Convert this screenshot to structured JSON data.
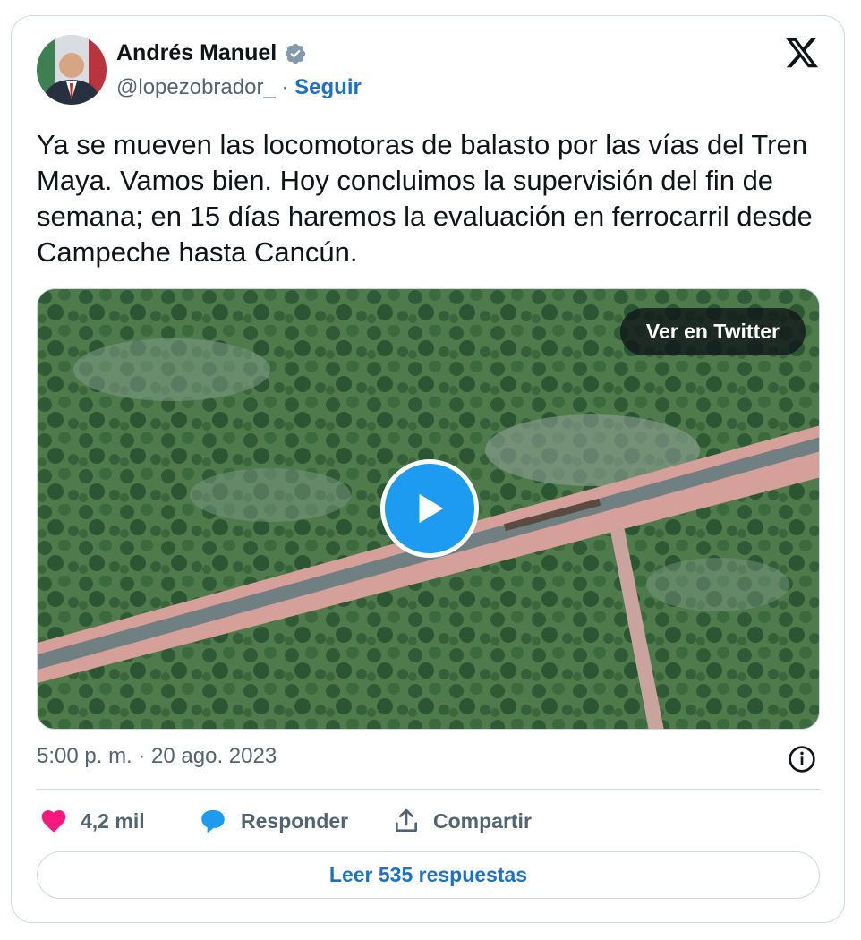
{
  "author": {
    "name": "Andrés Manuel",
    "handle": "@lopezobrador_",
    "separator": "·",
    "follow_label": "Seguir",
    "verified_icon": "verified-badge-icon"
  },
  "tweet": {
    "text": "Ya se mueven las locomotoras de balasto por las vías del Tren Maya. Vamos bien. Hoy concluimos la supervisión del fin de semana; en 15 días haremos la evaluación en ferrocarril desde Campeche hasta Cancún.",
    "timestamp": "5:00 p. m. · 20 ago. 2023"
  },
  "media": {
    "type": "video",
    "view_on_twitter_label": "Ver en Twitter",
    "play_icon": "play-icon"
  },
  "actions": {
    "likes_count": "4,2 mil",
    "reply_label": "Responder",
    "share_label": "Compartir"
  },
  "read_replies_label": "Leer 535 respuestas",
  "colors": {
    "link_blue": "#1d70c7",
    "play_blue": "#1d9bf0",
    "heart_pink": "#f91880",
    "reply_blue": "#1d9bf0",
    "muted_text": "#536471",
    "border": "#cfd9de"
  }
}
